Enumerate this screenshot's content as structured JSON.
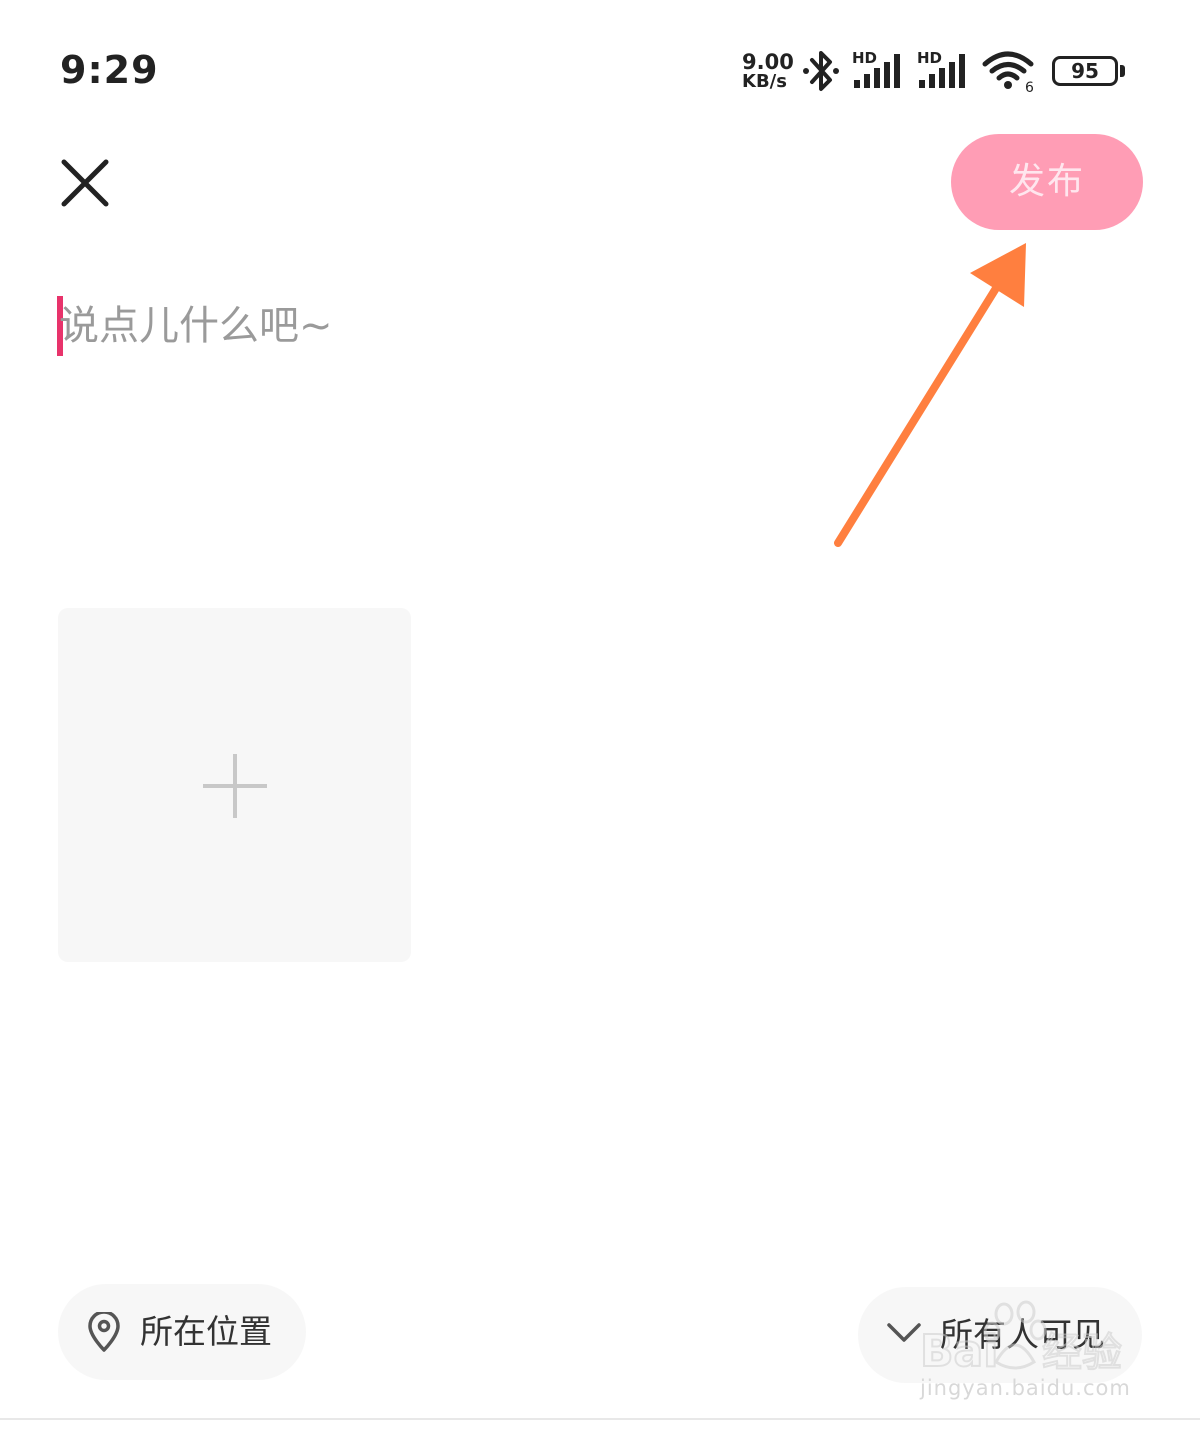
{
  "status_bar": {
    "time": "9:29",
    "net_speed_value": "9.00",
    "net_speed_unit": "KB/s",
    "bluetooth_icon": "bluetooth-icon",
    "signal_label": "HD",
    "wifi_icon": "wifi-icon",
    "wifi_badge": "6",
    "battery_level": "95"
  },
  "header": {
    "close_icon": "close-icon",
    "publish_label": "发布",
    "publish_color": "#ff9db5"
  },
  "editor": {
    "placeholder": "说点儿什么吧~",
    "value": "",
    "caret_color": "#e8336b"
  },
  "media": {
    "add_icon": "plus-icon"
  },
  "footer": {
    "location_label": "所在位置",
    "location_icon": "location-pin-icon",
    "visibility_label": "所有人可见",
    "visibility_icon": "chevron-down-icon"
  },
  "watermark": {
    "brand": "Baidu 经验",
    "url": "jingyan.baidu.com"
  },
  "colors": {
    "annotation_arrow": "#ff7f3f",
    "chip_background": "#f7f7f7"
  }
}
